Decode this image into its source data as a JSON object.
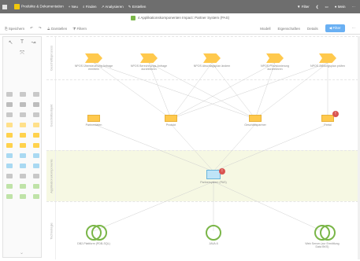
{
  "topbar": {
    "items": [
      "Produkte & Dokumentation",
      "Neu",
      "Finden",
      "Analysieren",
      "Erstellen"
    ],
    "right_items": [
      "Filter",
      "Mein"
    ]
  },
  "breadcrumb": {
    "title": "4 Applikationskomponenten Impact: Partner System (PAS)"
  },
  "toolbar": {
    "left": [
      "Speichern",
      "Darstellen",
      "Filtern"
    ],
    "right": [
      "Modell",
      "Eigenschaften",
      "Details",
      "Filter"
    ]
  },
  "lanes": [
    "Geschäftsprozess",
    "Geschäftsobjekt",
    "Applikationskomponente",
    "Technologie"
  ],
  "process_nodes": [
    "NPOS Übersteuerung Anfrage ermitteln",
    "NPOS Berechnungs-Anfrage durchführen",
    "NPOS Abschlagsplan ändern",
    "NPOS Provisionierung durchführen",
    "NPOS Zahlungsplan prüfen"
  ],
  "object_nodes": [
    "Partnerdaten",
    "Produkt",
    "Geschäftspartner",
    "Portal"
  ],
  "application_node": "Partnersystem (PAS)",
  "tech_nodes": [
    "DB2-Plattform (PDB-SQL)",
    "JAVA 8",
    "Web Server (zur Ermittlung Data BKS)"
  ],
  "colors": {
    "process": "#ffc94d",
    "app_lane": "#f6f8e3",
    "app": "#bfe4f7",
    "tech": "#7ab648",
    "badge": "#d9534f"
  },
  "badge_text": "!",
  "icons": [
    "search-icon",
    "gear-icon",
    "filter-icon",
    "home-icon",
    "user-icon"
  ]
}
